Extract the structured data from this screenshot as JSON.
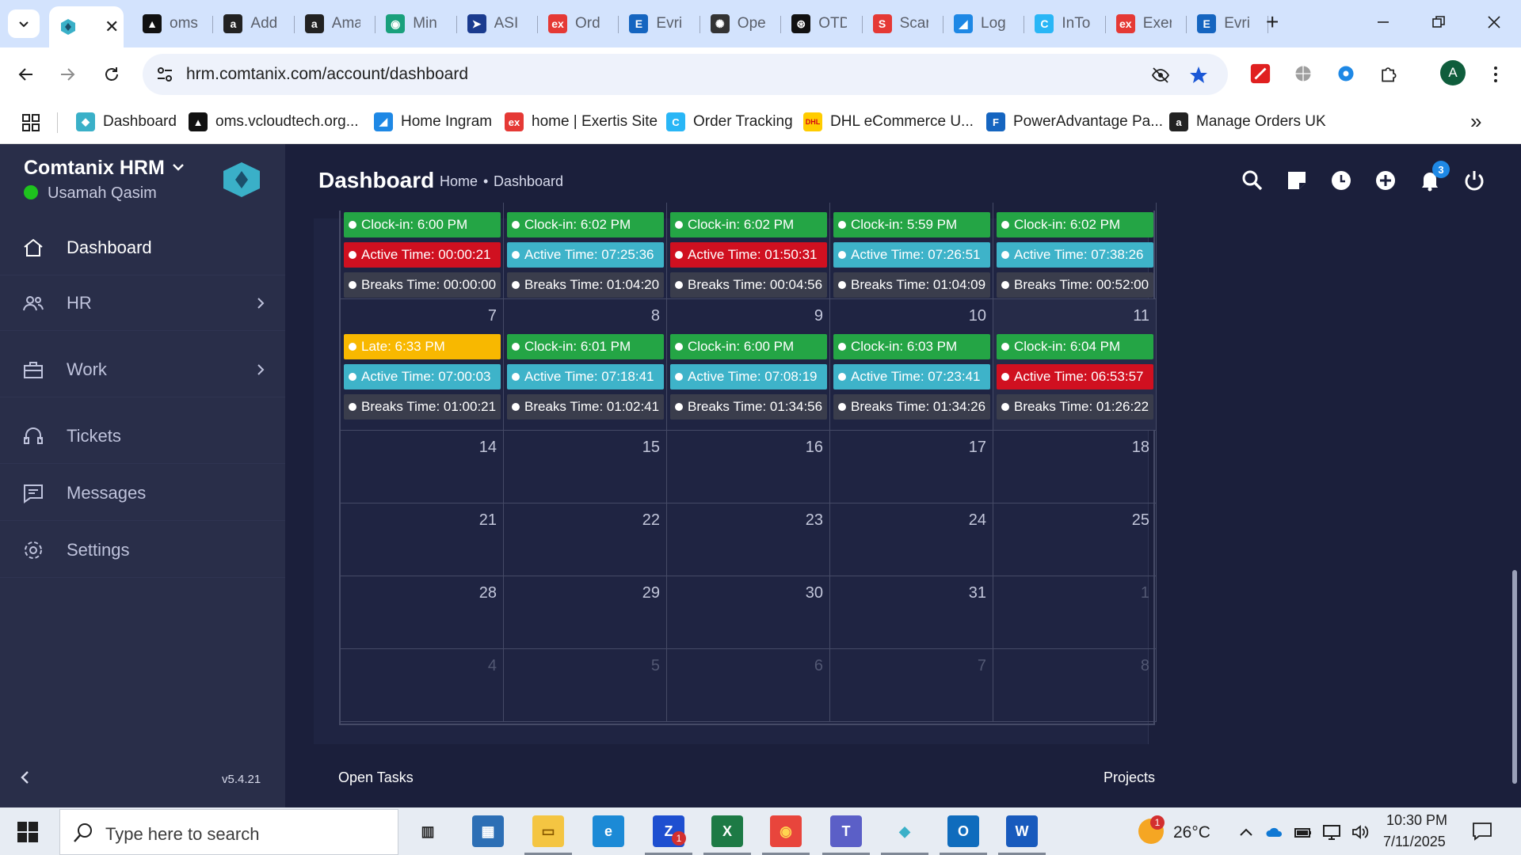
{
  "browser": {
    "active_tab_close": "✕",
    "tabs": [
      {
        "label": "oms",
        "fav": "▲",
        "color": "#111111"
      },
      {
        "label": "Add",
        "fav": "a",
        "color": "#222222"
      },
      {
        "label": "Ama",
        "fav": "a",
        "color": "#222222"
      },
      {
        "label": "Min",
        "fav": "◉",
        "color": "#19a07c"
      },
      {
        "label": "ASI",
        "fav": "➤",
        "color": "#1a3b8f"
      },
      {
        "label": "Ord",
        "fav": "ex",
        "color": "#e53935"
      },
      {
        "label": "Evri",
        "fav": "E",
        "color": "#1565c0"
      },
      {
        "label": "Ope",
        "fav": "✺",
        "color": "#333333"
      },
      {
        "label": "OTD",
        "fav": "⊛",
        "color": "#111111"
      },
      {
        "label": "Scar",
        "fav": "S",
        "color": "#e53935"
      },
      {
        "label": "Log",
        "fav": "◢",
        "color": "#1e88e5"
      },
      {
        "label": "InTo",
        "fav": "C",
        "color": "#29b6f6"
      },
      {
        "label": "Exer",
        "fav": "ex",
        "color": "#e53935"
      },
      {
        "label": "Evri",
        "fav": "E",
        "color": "#1565c0"
      }
    ],
    "new_tab": "+",
    "url": "hrm.comtanix.com/account/dashboard",
    "avatar_letter": "A",
    "bookmarks": [
      {
        "label": "Dashboard",
        "fav": "◆",
        "color": "#3ab0c8"
      },
      {
        "label": "oms.vcloudtech.org...",
        "fav": "▲",
        "color": "#111111"
      },
      {
        "label": "Home Ingram",
        "fav": "◢",
        "color": "#1e88e5"
      },
      {
        "label": "home | Exertis Site",
        "fav": "ex",
        "color": "#e53935"
      },
      {
        "label": "Order Tracking",
        "fav": "C",
        "color": "#29b6f6"
      },
      {
        "label": "DHL eCommerce U...",
        "fav": "DHL",
        "color": "#ffcc00"
      },
      {
        "label": "PowerAdvantage Pa...",
        "fav": "F",
        "color": "#1565c0"
      },
      {
        "label": "Manage Orders UK",
        "fav": "a",
        "color": "#222222"
      }
    ],
    "more_bookmarks": "»"
  },
  "app": {
    "brand": "Comtanix HRM",
    "user_name": "Usamah Qasim",
    "status_color": "#1ec31e",
    "nav": [
      {
        "label": "Dashboard",
        "icon": "home-icon",
        "active": true,
        "arrow": false
      },
      {
        "label": "HR",
        "icon": "users-icon",
        "active": false,
        "arrow": true
      },
      {
        "label": "Work",
        "icon": "briefcase-icon",
        "active": false,
        "arrow": true
      },
      {
        "label": "Tickets",
        "icon": "headset-icon",
        "active": false,
        "arrow": false
      },
      {
        "label": "Messages",
        "icon": "message-icon",
        "active": false,
        "arrow": false
      },
      {
        "label": "Settings",
        "icon": "gear-icon",
        "active": false,
        "arrow": false
      }
    ],
    "version": "v5.4.21",
    "page_title": "Dashboard",
    "breadcrumb": {
      "home": "Home",
      "separator": "•",
      "current": "Dashboard"
    },
    "notification_count": "3",
    "open_tasks": "Open Tasks",
    "projects": "Projects"
  },
  "calendar": {
    "colors": {
      "green": "#24a545",
      "red": "#d01020",
      "teal": "#3eb3c9",
      "dark": "#3a3d4c",
      "yellow": "#f8b800"
    },
    "partial_row": [
      [
        {
          "type": "green",
          "text": "Clock-in: 6:00 PM"
        },
        {
          "type": "red",
          "text": "Active Time: 00:00:21"
        },
        {
          "type": "dark",
          "text": "Breaks Time: 00:00:00"
        }
      ],
      [
        {
          "type": "green",
          "text": "Clock-in: 6:02 PM"
        },
        {
          "type": "teal",
          "text": "Active Time: 07:25:36"
        },
        {
          "type": "dark",
          "text": "Breaks Time: 01:04:20"
        }
      ],
      [
        {
          "type": "green",
          "text": "Clock-in: 6:02 PM"
        },
        {
          "type": "red",
          "text": "Active Time: 01:50:31"
        },
        {
          "type": "dark",
          "text": "Breaks Time: 00:04:56"
        }
      ],
      [
        {
          "type": "green",
          "text": "Clock-in: 5:59 PM"
        },
        {
          "type": "teal",
          "text": "Active Time: 07:26:51"
        },
        {
          "type": "dark",
          "text": "Breaks Time: 01:04:09"
        }
      ],
      [
        {
          "type": "green",
          "text": "Clock-in: 6:02 PM"
        },
        {
          "type": "teal",
          "text": "Active Time: 07:38:26"
        },
        {
          "type": "dark",
          "text": "Breaks Time: 00:52:00"
        }
      ]
    ],
    "weeks": [
      {
        "days": [
          {
            "day": "7",
            "muted": false,
            "today": false,
            "events": [
              {
                "type": "yellow",
                "text": "Late: 6:33 PM"
              },
              {
                "type": "teal",
                "text": "Active Time: 07:00:03"
              },
              {
                "type": "dark",
                "text": "Breaks Time: 01:00:21"
              }
            ]
          },
          {
            "day": "8",
            "muted": false,
            "today": false,
            "events": [
              {
                "type": "green",
                "text": "Clock-in: 6:01 PM"
              },
              {
                "type": "teal",
                "text": "Active Time: 07:18:41"
              },
              {
                "type": "dark",
                "text": "Breaks Time: 01:02:41"
              }
            ]
          },
          {
            "day": "9",
            "muted": false,
            "today": false,
            "events": [
              {
                "type": "green",
                "text": "Clock-in: 6:00 PM"
              },
              {
                "type": "teal",
                "text": "Active Time: 07:08:19"
              },
              {
                "type": "dark",
                "text": "Breaks Time: 01:34:56"
              }
            ]
          },
          {
            "day": "10",
            "muted": false,
            "today": false,
            "events": [
              {
                "type": "green",
                "text": "Clock-in: 6:03 PM"
              },
              {
                "type": "teal",
                "text": "Active Time: 07:23:41"
              },
              {
                "type": "dark",
                "text": "Breaks Time: 01:34:26"
              }
            ]
          },
          {
            "day": "11",
            "muted": false,
            "today": true,
            "events": [
              {
                "type": "green",
                "text": "Clock-in: 6:04 PM"
              },
              {
                "type": "red",
                "text": "Active Time: 06:53:57"
              },
              {
                "type": "dark",
                "text": "Breaks Time: 01:26:22"
              }
            ]
          }
        ]
      },
      {
        "days": [
          {
            "day": "14",
            "muted": false,
            "today": false,
            "events": []
          },
          {
            "day": "15",
            "muted": false,
            "today": false,
            "events": []
          },
          {
            "day": "16",
            "muted": false,
            "today": false,
            "events": []
          },
          {
            "day": "17",
            "muted": false,
            "today": false,
            "events": []
          },
          {
            "day": "18",
            "muted": false,
            "today": false,
            "events": []
          }
        ]
      },
      {
        "days": [
          {
            "day": "21",
            "muted": false,
            "today": false,
            "events": []
          },
          {
            "day": "22",
            "muted": false,
            "today": false,
            "events": []
          },
          {
            "day": "23",
            "muted": false,
            "today": false,
            "events": []
          },
          {
            "day": "24",
            "muted": false,
            "today": false,
            "events": []
          },
          {
            "day": "25",
            "muted": false,
            "today": false,
            "events": []
          }
        ]
      },
      {
        "days": [
          {
            "day": "28",
            "muted": false,
            "today": false,
            "events": []
          },
          {
            "day": "29",
            "muted": false,
            "today": false,
            "events": []
          },
          {
            "day": "30",
            "muted": false,
            "today": false,
            "events": []
          },
          {
            "day": "31",
            "muted": false,
            "today": false,
            "events": []
          },
          {
            "day": "1",
            "muted": true,
            "today": false,
            "events": []
          }
        ]
      },
      {
        "days": [
          {
            "day": "4",
            "muted": true,
            "today": false,
            "events": []
          },
          {
            "day": "5",
            "muted": true,
            "today": false,
            "events": []
          },
          {
            "day": "6",
            "muted": true,
            "today": false,
            "events": []
          },
          {
            "day": "7",
            "muted": true,
            "today": false,
            "events": []
          },
          {
            "day": "8",
            "muted": true,
            "today": false,
            "events": []
          }
        ]
      }
    ]
  },
  "taskbar": {
    "search_placeholder": "Type here to search",
    "apps": [
      {
        "name": "task-view-icon",
        "glyph": "▥",
        "color": "#e7ecf3",
        "fg": "#222222"
      },
      {
        "name": "calculator-icon",
        "glyph": "▦",
        "color": "#2d6fb5",
        "fg": "#ffffff"
      },
      {
        "name": "file-explorer-icon",
        "glyph": "▭",
        "color": "#f4c542",
        "fg": "#8a5a00"
      },
      {
        "name": "edge-icon",
        "glyph": "e",
        "color": "#1c8ad6",
        "fg": "#ffffff"
      },
      {
        "name": "zoho-icon",
        "glyph": "Z",
        "color": "#1e4fd0",
        "fg": "#ffffff"
      },
      {
        "name": "excel-icon",
        "glyph": "X",
        "color": "#1d7a45",
        "fg": "#ffffff"
      },
      {
        "name": "chrome-icon",
        "glyph": "◉",
        "color": "#e8453c",
        "fg": "#ffd54f"
      },
      {
        "name": "teams-icon",
        "glyph": "T",
        "color": "#5b5fc7",
        "fg": "#ffffff"
      },
      {
        "name": "hrm-app-icon",
        "glyph": "◆",
        "color": "#e7ecf3",
        "fg": "#3ab0c8"
      },
      {
        "name": "outlook-icon",
        "glyph": "O",
        "color": "#0f6cbd",
        "fg": "#ffffff"
      },
      {
        "name": "word-icon",
        "glyph": "W",
        "color": "#185abd",
        "fg": "#ffffff"
      }
    ],
    "zoho_badge": "1",
    "weather_badge": "1",
    "temperature": "26°C",
    "time": "10:30 PM",
    "date": "7/11/2025"
  }
}
